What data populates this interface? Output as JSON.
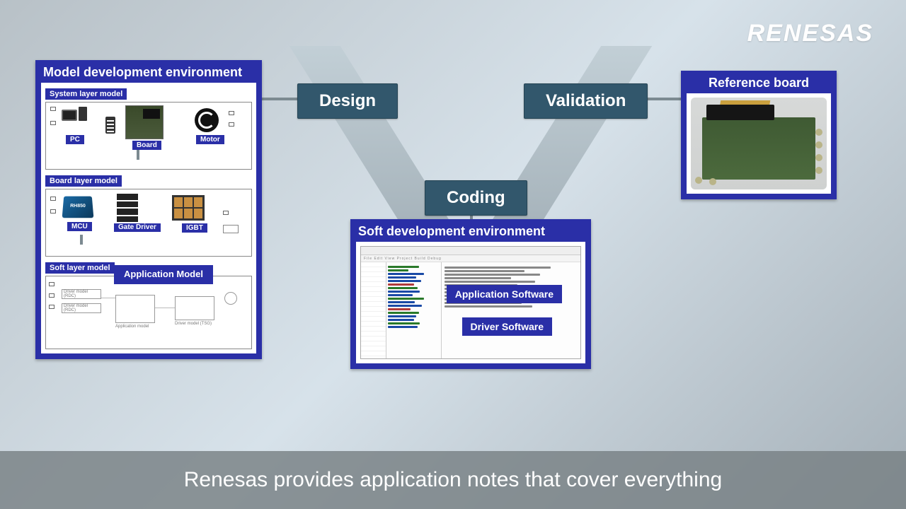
{
  "brand": "RENESAS",
  "stages": {
    "design": "Design",
    "validation": "Validation",
    "coding": "Coding"
  },
  "model_env": {
    "title": "Model development environment",
    "system": {
      "band": "System layer model",
      "pc": "PC",
      "board": "Board",
      "motor": "Motor"
    },
    "board": {
      "band": "Board layer model",
      "mcu": "MCU",
      "mcu_chip": "RH850",
      "gate": "Gate Driver",
      "igbt": "IGBT"
    },
    "soft": {
      "band": "Soft layer model",
      "app_model": "Application Model",
      "drv_rdc": "Driver model (RDC)",
      "app_m": "Application model",
      "drv_tsg": "Driver model (TSG)"
    }
  },
  "soft_env": {
    "title": "Soft development environment",
    "app_sw": "Application Software",
    "drv_sw": "Driver Software"
  },
  "reference": {
    "title": "Reference board"
  },
  "caption": "Renesas provides application notes that cover everything"
}
